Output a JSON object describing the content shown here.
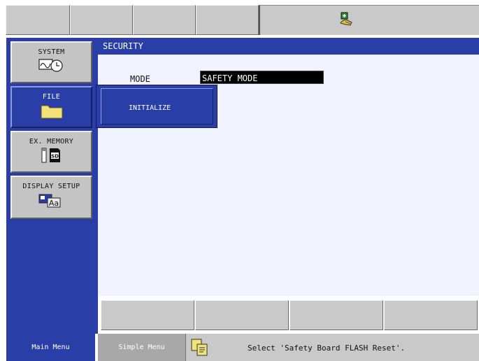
{
  "top_bar": {
    "buttons": [
      "",
      "",
      "",
      ""
    ],
    "status_icon": "robot-hand-icon"
  },
  "sidebar": {
    "items": [
      {
        "label": "SYSTEM",
        "icon": "system-clock-icon"
      },
      {
        "label": "FILE",
        "icon": "folder-icon"
      },
      {
        "label": "EX. MEMORY",
        "icon": "sd-card-icon"
      },
      {
        "label": "DISPLAY SETUP",
        "icon": "display-font-icon"
      }
    ]
  },
  "main": {
    "title": "SECURITY",
    "mode_label": "MODE",
    "mode_value": "SAFETY MODE"
  },
  "popup": {
    "items": [
      "INITIALIZE"
    ]
  },
  "function_keys": [
    "",
    "",
    "",
    ""
  ],
  "bottom": {
    "main_menu": "Main Menu",
    "simple_menu": "Simple Menu",
    "message": "Select 'Safety Board FLASH Reset'.",
    "message_icon": "copy-pages-icon"
  },
  "colors": {
    "panel_blue": "#2a3ea8",
    "content_bg": "#f0f2ff",
    "highlight_field": "#000000"
  }
}
